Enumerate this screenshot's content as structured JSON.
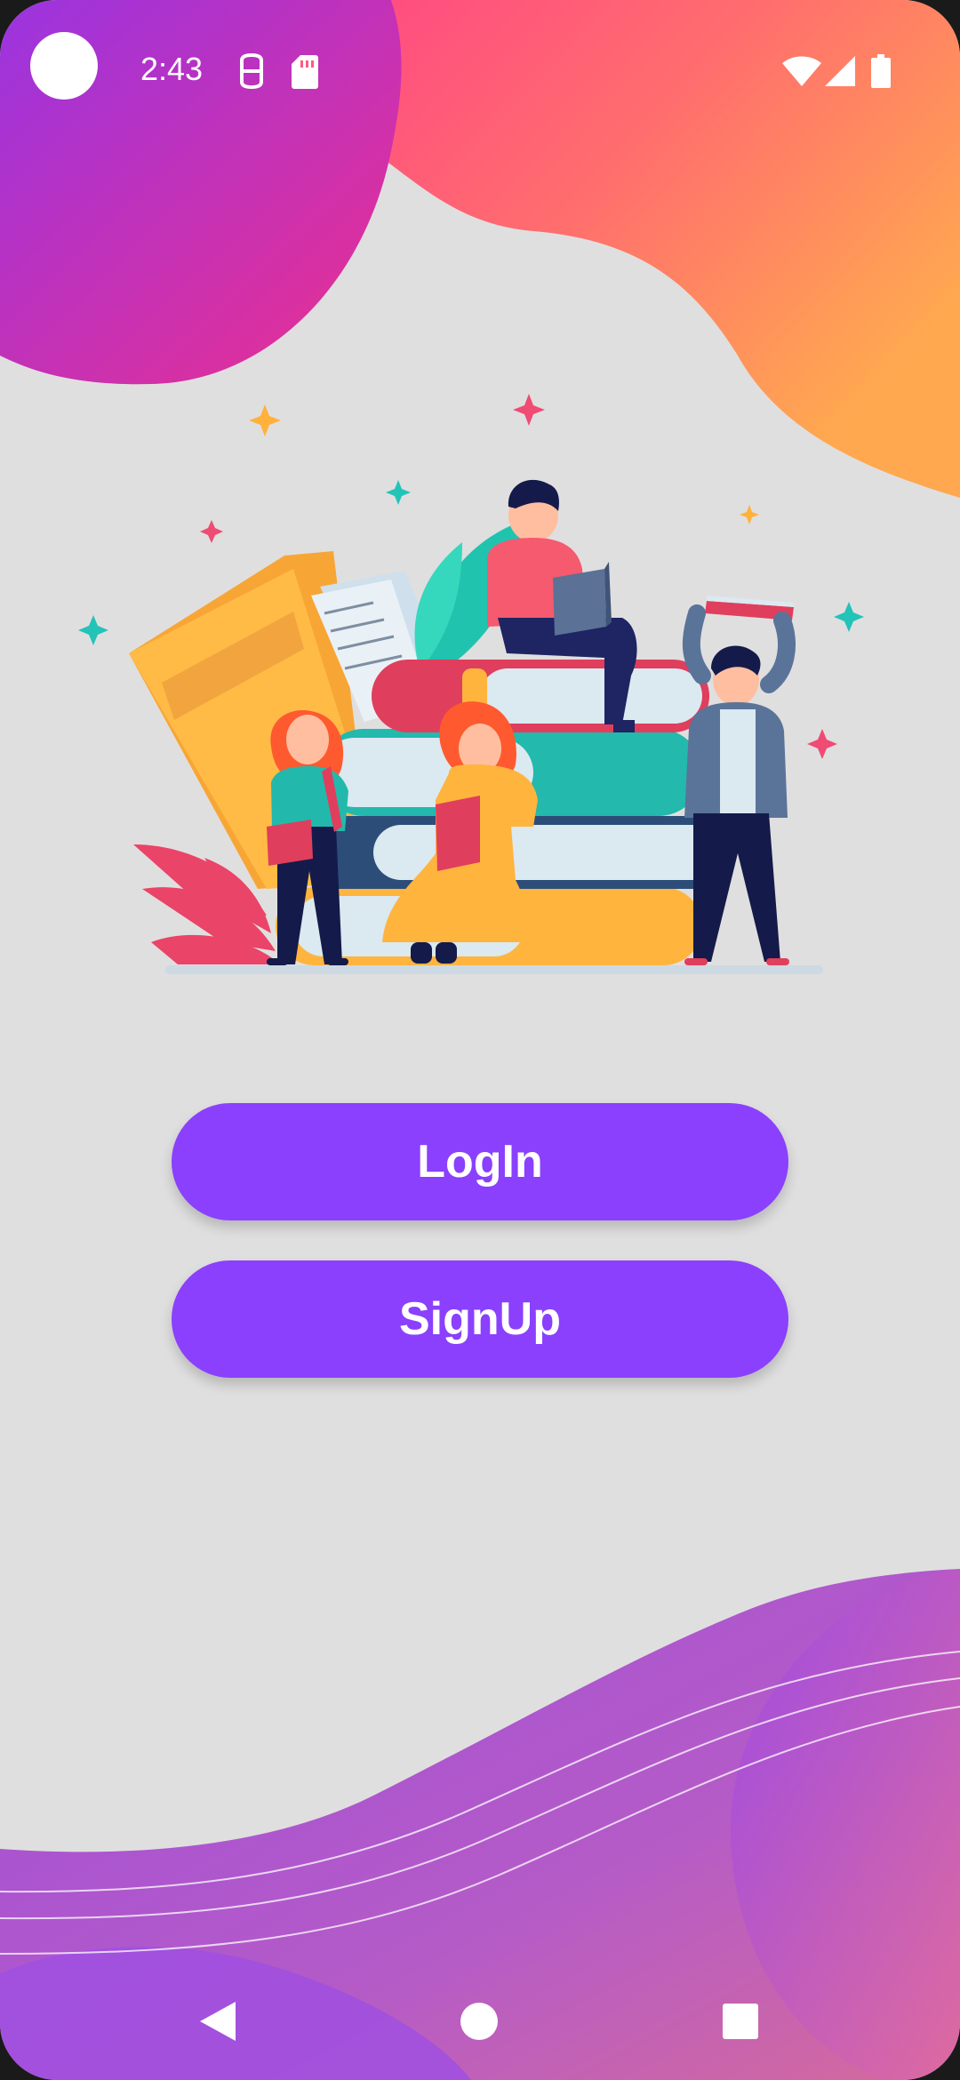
{
  "status_bar": {
    "time": "2:43",
    "icons": [
      "camera-cutout",
      "sim-settings-icon",
      "sd-card-icon",
      "wifi-icon",
      "cell-signal-icon",
      "battery-icon"
    ]
  },
  "actions": {
    "login_label": "LogIn",
    "signup_label": "SignUp"
  },
  "illustration": {
    "subject": "people-reading-books-icon"
  },
  "nav_bar": {
    "buttons": [
      "back-icon",
      "home-icon",
      "recents-icon"
    ]
  },
  "colors": {
    "background": "#e0dfdf",
    "button": "#8a40fd",
    "button_text": "#ffffff",
    "top_gradient_start": "#a13ad8",
    "top_gradient_end": "#ffa04f",
    "bottom_wave": "#a54fd9"
  }
}
